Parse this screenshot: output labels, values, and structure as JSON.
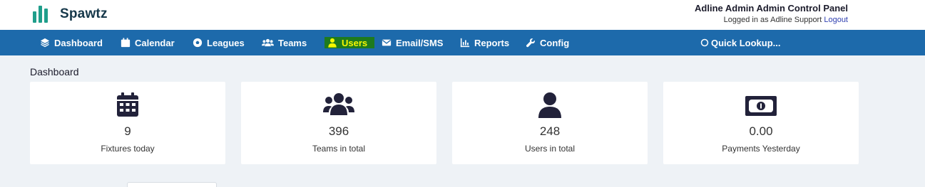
{
  "brand": {
    "name": "Spawtz",
    "color": "#1f9e8b"
  },
  "header": {
    "title": "Adline Admin Admin Control Panel",
    "logged_in_text": "Logged in as Adline Support",
    "logout_label": "Logout"
  },
  "nav": {
    "bg_color": "#1d6aab",
    "items": [
      {
        "label": "Dashboard",
        "icon": "layers-icon"
      },
      {
        "label": "Calendar",
        "icon": "calendar-icon"
      },
      {
        "label": "Leagues",
        "icon": "soccer-ball-icon"
      },
      {
        "label": "Teams",
        "icon": "users-icon"
      },
      {
        "label": "Users",
        "icon": "user-icon",
        "active": true
      },
      {
        "label": "Email/SMS",
        "icon": "envelope-icon"
      },
      {
        "label": "Reports",
        "icon": "chart-icon"
      },
      {
        "label": "Config",
        "icon": "wrench-icon"
      }
    ],
    "quick_lookup": "Quick Lookup..."
  },
  "main": {
    "title": "Dashboard",
    "cards": [
      {
        "value": "9",
        "label": "Fixtures today",
        "icon": "calendar-icon"
      },
      {
        "value": "396",
        "label": "Teams in total",
        "icon": "users-icon"
      },
      {
        "value": "248",
        "label": "Users in total",
        "icon": "user-icon"
      },
      {
        "value": "0.00",
        "label": "Payments Yesterday",
        "icon": "money-bill-icon"
      }
    ]
  }
}
